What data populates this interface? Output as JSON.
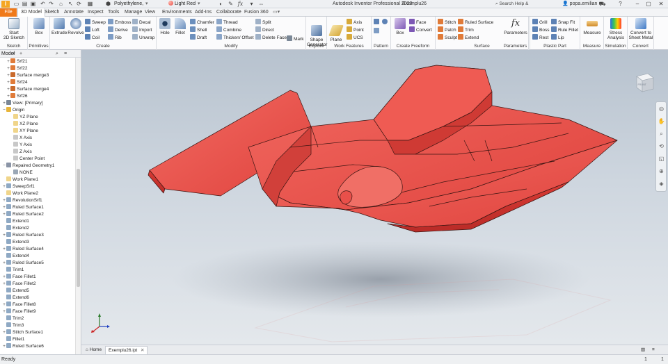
{
  "titlebar": {
    "app_logo": "I",
    "material": "Polyethylene,",
    "appearance": "Light Red",
    "app_title": "Autodesk Inventor Professional 2023",
    "doc_title": "Exemplu26",
    "help_search": "Search Help & Commands...",
    "user": "popa.emilian",
    "fx_icon": "fx",
    "qat_icons": [
      "new-icon",
      "open-icon",
      "save-icon",
      "undo-icon",
      "redo-icon",
      "home-icon",
      "select-icon"
    ]
  },
  "tabs": [
    {
      "label": "File"
    },
    {
      "label": "3D Model"
    },
    {
      "label": "Sketch"
    },
    {
      "label": "Annotate"
    },
    {
      "label": "Inspect"
    },
    {
      "label": "Tools"
    },
    {
      "label": "Manage"
    },
    {
      "label": "View"
    },
    {
      "label": "Environments"
    },
    {
      "label": "Add-Ins"
    },
    {
      "label": "Collaborate"
    },
    {
      "label": "Fusion 360"
    }
  ],
  "ribbon": {
    "sketch": {
      "label": "Sketch",
      "start": "Start",
      "start2": "2D Sketch"
    },
    "primitives": {
      "label": "Primitives",
      "box": "Box"
    },
    "create": {
      "label": "Create",
      "extrude": "Extrude",
      "revolve": "Revolve",
      "sweep": "Sweep",
      "loft": "Loft",
      "coil": "Coil",
      "emboss": "Emboss",
      "derive": "Derive",
      "rib": "Rib",
      "decal": "Decal",
      "import": "Import",
      "unwrap": "Unwrap"
    },
    "modify": {
      "label": "Modify",
      "hole": "Hole",
      "fillet": "Fillet",
      "chamfer": "Chamfer",
      "shell": "Shell",
      "draft": "Draft",
      "thread": "Thread",
      "combine": "Combine",
      "thicken": "Thicken/ Offset",
      "split": "Split",
      "direct": "Direct",
      "delete_face": "Delete Face"
    },
    "explore": {
      "label": "Explore",
      "mark": "Mark",
      "shape": "Shape",
      "shape2": "Generator"
    },
    "work": {
      "label": "Work Features",
      "plane": "Plane",
      "axis": "Axis",
      "point": "Point",
      "ucs": "UCS"
    },
    "pattern": {
      "label": "Pattern"
    },
    "freeform": {
      "label": "Create Freeform",
      "box": "Box",
      "face": "Face",
      "convert": "Convert"
    },
    "surface": {
      "label": "Surface",
      "stitch": "Stitch",
      "patch": "Patch",
      "sculpt": "Sculpt",
      "ruled": "Ruled Surface",
      "trim": "Trim",
      "extend": "Extend"
    },
    "parameters": {
      "label": "Parameters",
      "fx": "fx",
      "btn": "Parameters"
    },
    "plastic": {
      "label": "Plastic Part",
      "grill": "Grill",
      "boss": "Boss",
      "rest": "Rest",
      "snap": "Snap Fit",
      "rule_fillet": "Rule Fillet",
      "lip": "Lip"
    },
    "measure": {
      "label": "Measure",
      "btn": "Measure"
    },
    "simulation": {
      "label": "Simulation",
      "btn": "Stress",
      "btn2": "Analysis"
    },
    "convert": {
      "label": "Convert",
      "btn": "Convert to",
      "btn2": "Sheet Metal"
    }
  },
  "browser": {
    "title": "Model",
    "items": [
      {
        "label": "Srf21",
        "exp": "+",
        "color": "#e07b39"
      },
      {
        "label": "Srf22",
        "exp": "+",
        "color": "#e07b39"
      },
      {
        "label": "Surface merge3",
        "exp": "+",
        "color": "#c96a2c"
      },
      {
        "label": "Srf24",
        "exp": "+",
        "color": "#e07b39"
      },
      {
        "label": "Surface merge4",
        "exp": "+",
        "color": "#c96a2c"
      },
      {
        "label": "Srf26",
        "exp": "+",
        "color": "#e07b39"
      },
      {
        "label": "View: [Primary]",
        "exp": "+",
        "color": "#7a8796"
      },
      {
        "label": "Origin",
        "exp": "−",
        "color": "#e8b53a"
      },
      {
        "label": "YZ Plane",
        "exp": "",
        "color": "#f0d58a"
      },
      {
        "label": "XZ Plane",
        "exp": "",
        "color": "#f0d58a"
      },
      {
        "label": "XY Plane",
        "exp": "",
        "color": "#f0d58a"
      },
      {
        "label": "X Axis",
        "exp": "",
        "color": "#c8c8c8"
      },
      {
        "label": "Y Axis",
        "exp": "",
        "color": "#c8c8c8"
      },
      {
        "label": "Z Axis",
        "exp": "",
        "color": "#c8c8c8"
      },
      {
        "label": "Center Point",
        "exp": "",
        "color": "#c8c8c8"
      },
      {
        "label": "Repaired Geometry1",
        "exp": "−",
        "color": "#8a94a6"
      },
      {
        "label": "NONE",
        "exp": "",
        "color": "#9aa7b6"
      },
      {
        "label": "Work Plane1",
        "exp": "",
        "color": "#f0d58a"
      },
      {
        "label": "SweepSrf1",
        "exp": "+",
        "color": "#8fa9c4"
      },
      {
        "label": "Work Plane2",
        "exp": "",
        "color": "#f0d58a"
      },
      {
        "label": "RevolutionSrf1",
        "exp": "+",
        "color": "#8fa9c4"
      },
      {
        "label": "Ruled Surface1",
        "exp": "+",
        "color": "#8fa9c4"
      },
      {
        "label": "Ruled Surface2",
        "exp": "+",
        "color": "#8fa9c4"
      },
      {
        "label": "Extend1",
        "exp": "",
        "color": "#8fa9c4"
      },
      {
        "label": "Extend2",
        "exp": "",
        "color": "#8fa9c4"
      },
      {
        "label": "Ruled Surface3",
        "exp": "+",
        "color": "#8fa9c4"
      },
      {
        "label": "Extend3",
        "exp": "",
        "color": "#8fa9c4"
      },
      {
        "label": "Ruled Surface4",
        "exp": "+",
        "color": "#8fa9c4"
      },
      {
        "label": "Extend4",
        "exp": "",
        "color": "#8fa9c4"
      },
      {
        "label": "Ruled Surface5",
        "exp": "+",
        "color": "#8fa9c4"
      },
      {
        "label": "Trim1",
        "exp": "",
        "color": "#8fa9c4"
      },
      {
        "label": "Face Fillet1",
        "exp": "+",
        "color": "#8fa9c4"
      },
      {
        "label": "Face Fillet2",
        "exp": "+",
        "color": "#8fa9c4"
      },
      {
        "label": "Extend5",
        "exp": "",
        "color": "#8fa9c4"
      },
      {
        "label": "Extend6",
        "exp": "",
        "color": "#8fa9c4"
      },
      {
        "label": "Face Fillet8",
        "exp": "+",
        "color": "#8fa9c4"
      },
      {
        "label": "Face Fillet9",
        "exp": "+",
        "color": "#8fa9c4"
      },
      {
        "label": "Trim2",
        "exp": "",
        "color": "#8fa9c4"
      },
      {
        "label": "Trim3",
        "exp": "",
        "color": "#8fa9c4"
      },
      {
        "label": "Stitch Surface1",
        "exp": "+",
        "color": "#8fa9c4"
      },
      {
        "label": "Fillet1",
        "exp": "",
        "color": "#8fa9c4"
      },
      {
        "label": "Ruled Surface6",
        "exp": "+",
        "color": "#8fa9c4"
      }
    ]
  },
  "viewcube": {
    "face": "FRONT"
  },
  "doctabs": [
    {
      "label": "Home"
    },
    {
      "label": "Exemplu26.ipt"
    }
  ],
  "status": {
    "text": "Ready",
    "count1": "1",
    "count2": "1"
  },
  "colors": {
    "model_red": "#e8504a",
    "accent": "#f07a1a"
  }
}
